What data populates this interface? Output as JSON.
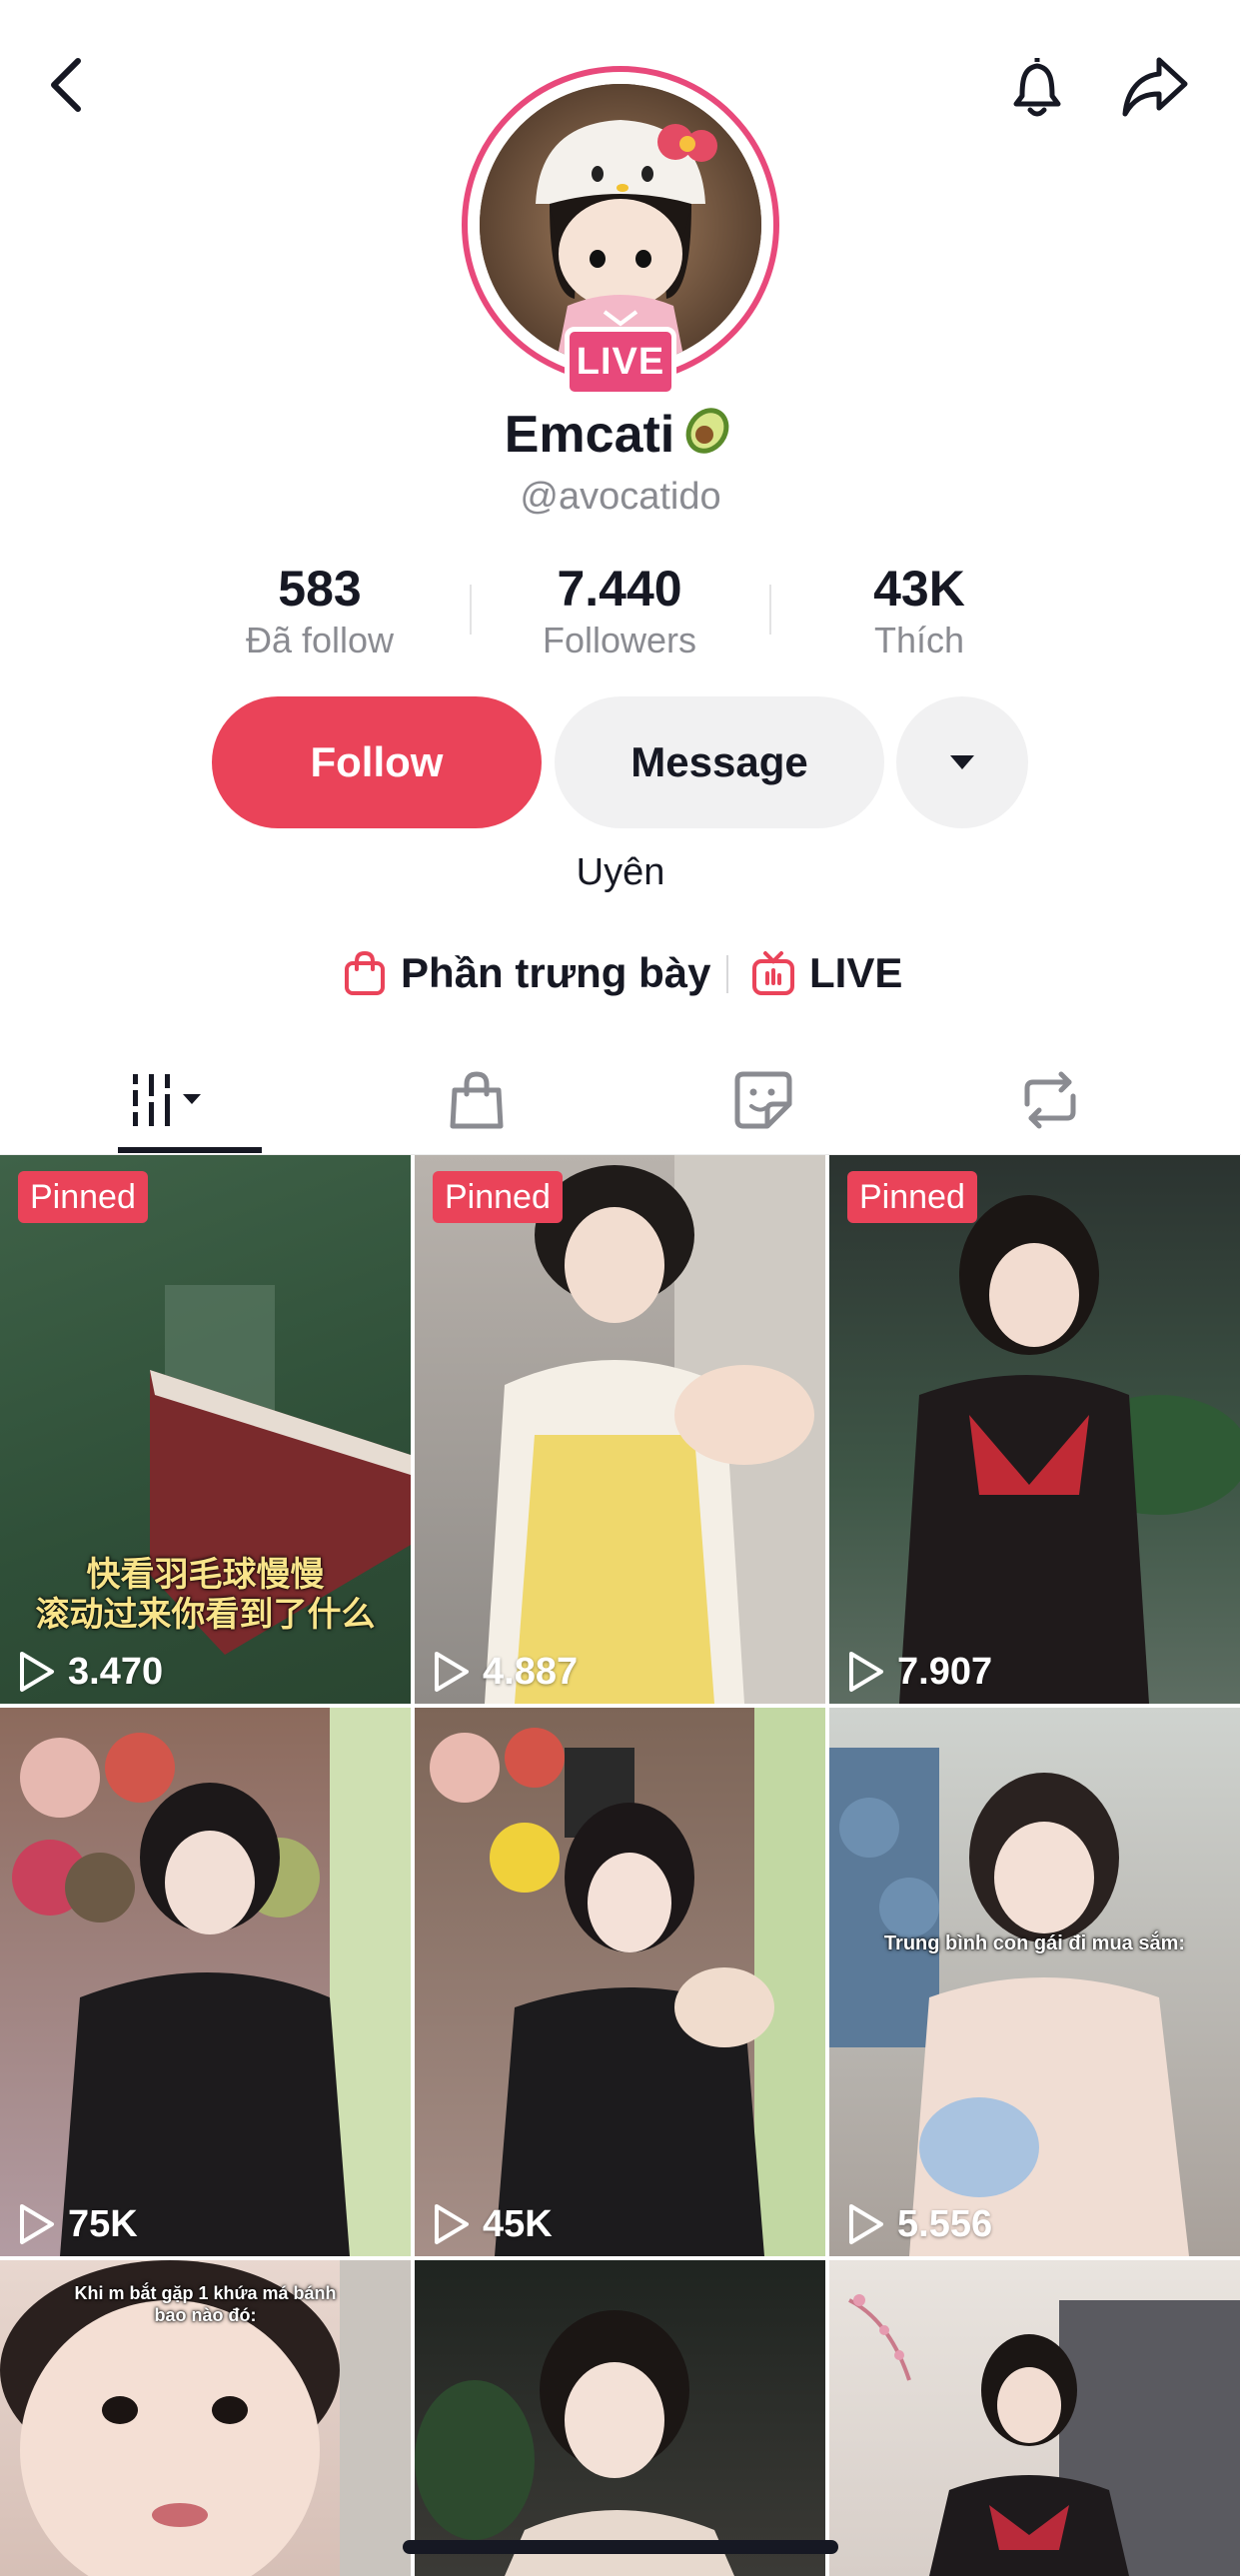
{
  "header": {
    "back_icon": "chevron-left-icon",
    "notification_icon": "bell-icon",
    "share_icon": "share-arrow-icon"
  },
  "profile": {
    "live_badge": "LIVE",
    "display_name": "Emcati",
    "name_emoji": "avocado-emoji",
    "username": "@avocatido",
    "bio": "Uyên",
    "ring_color": "#e8497b"
  },
  "stats": [
    {
      "value": "583",
      "label": "Đã follow"
    },
    {
      "value": "7.440",
      "label": "Followers"
    },
    {
      "value": "43K",
      "label": "Thích"
    }
  ],
  "actions": {
    "follow_label": "Follow",
    "message_label": "Message",
    "more_icon": "caret-down-icon",
    "accent_color": "#ea4359"
  },
  "links": {
    "showcase_label": "Phần trưng bày",
    "live_label": "LIVE"
  },
  "tabs": [
    {
      "name": "videos",
      "icon": "grid-columns-icon",
      "active": true
    },
    {
      "name": "shop",
      "icon": "shopping-bag-icon",
      "active": false
    },
    {
      "name": "stickers",
      "icon": "sticker-icon",
      "active": false
    },
    {
      "name": "reposts",
      "icon": "repost-icon",
      "active": false
    }
  ],
  "videos": [
    {
      "pinned": "Pinned",
      "views": "3.470",
      "caption": "快看羽毛球慢慢\n滚动过来你看到了什么"
    },
    {
      "pinned": "Pinned",
      "views": "4.887",
      "caption": ""
    },
    {
      "pinned": "Pinned",
      "views": "7.907",
      "caption": ""
    },
    {
      "pinned": "",
      "views": "75K",
      "caption": ""
    },
    {
      "pinned": "",
      "views": "45K",
      "caption": ""
    },
    {
      "pinned": "",
      "views": "5.556",
      "caption": "Trung bình con gái đi mua sắm:"
    },
    {
      "pinned": "",
      "views": "",
      "caption": "Khi m bắt gặp 1 khứa má bánh\nbao nào đó:"
    },
    {
      "pinned": "",
      "views": "",
      "caption": ""
    },
    {
      "pinned": "",
      "views": "",
      "caption": ""
    }
  ]
}
